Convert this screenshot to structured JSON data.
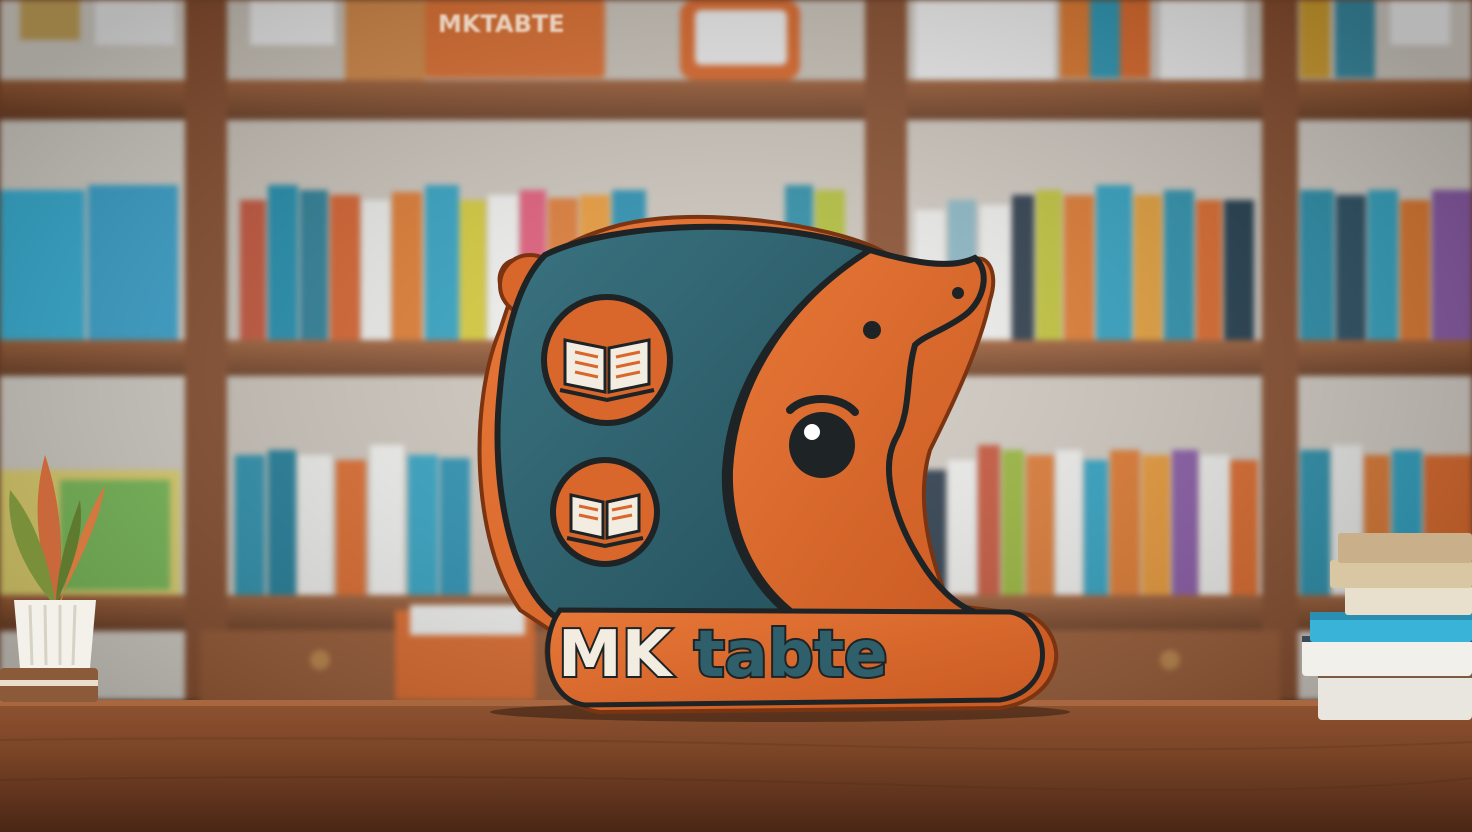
{
  "logo": {
    "wordmark_part1": "MK",
    "wordmark_part2": "tabte",
    "sign_text": "MKTABTE"
  },
  "colors": {
    "brand_orange": "#d9672b",
    "brand_teal": "#2e5f6b",
    "outline_dark": "#1e2326",
    "cream": "#f3ece0",
    "wood": "#8a4f2e",
    "wood_dark": "#5c3622",
    "desk": "#7a4427"
  }
}
